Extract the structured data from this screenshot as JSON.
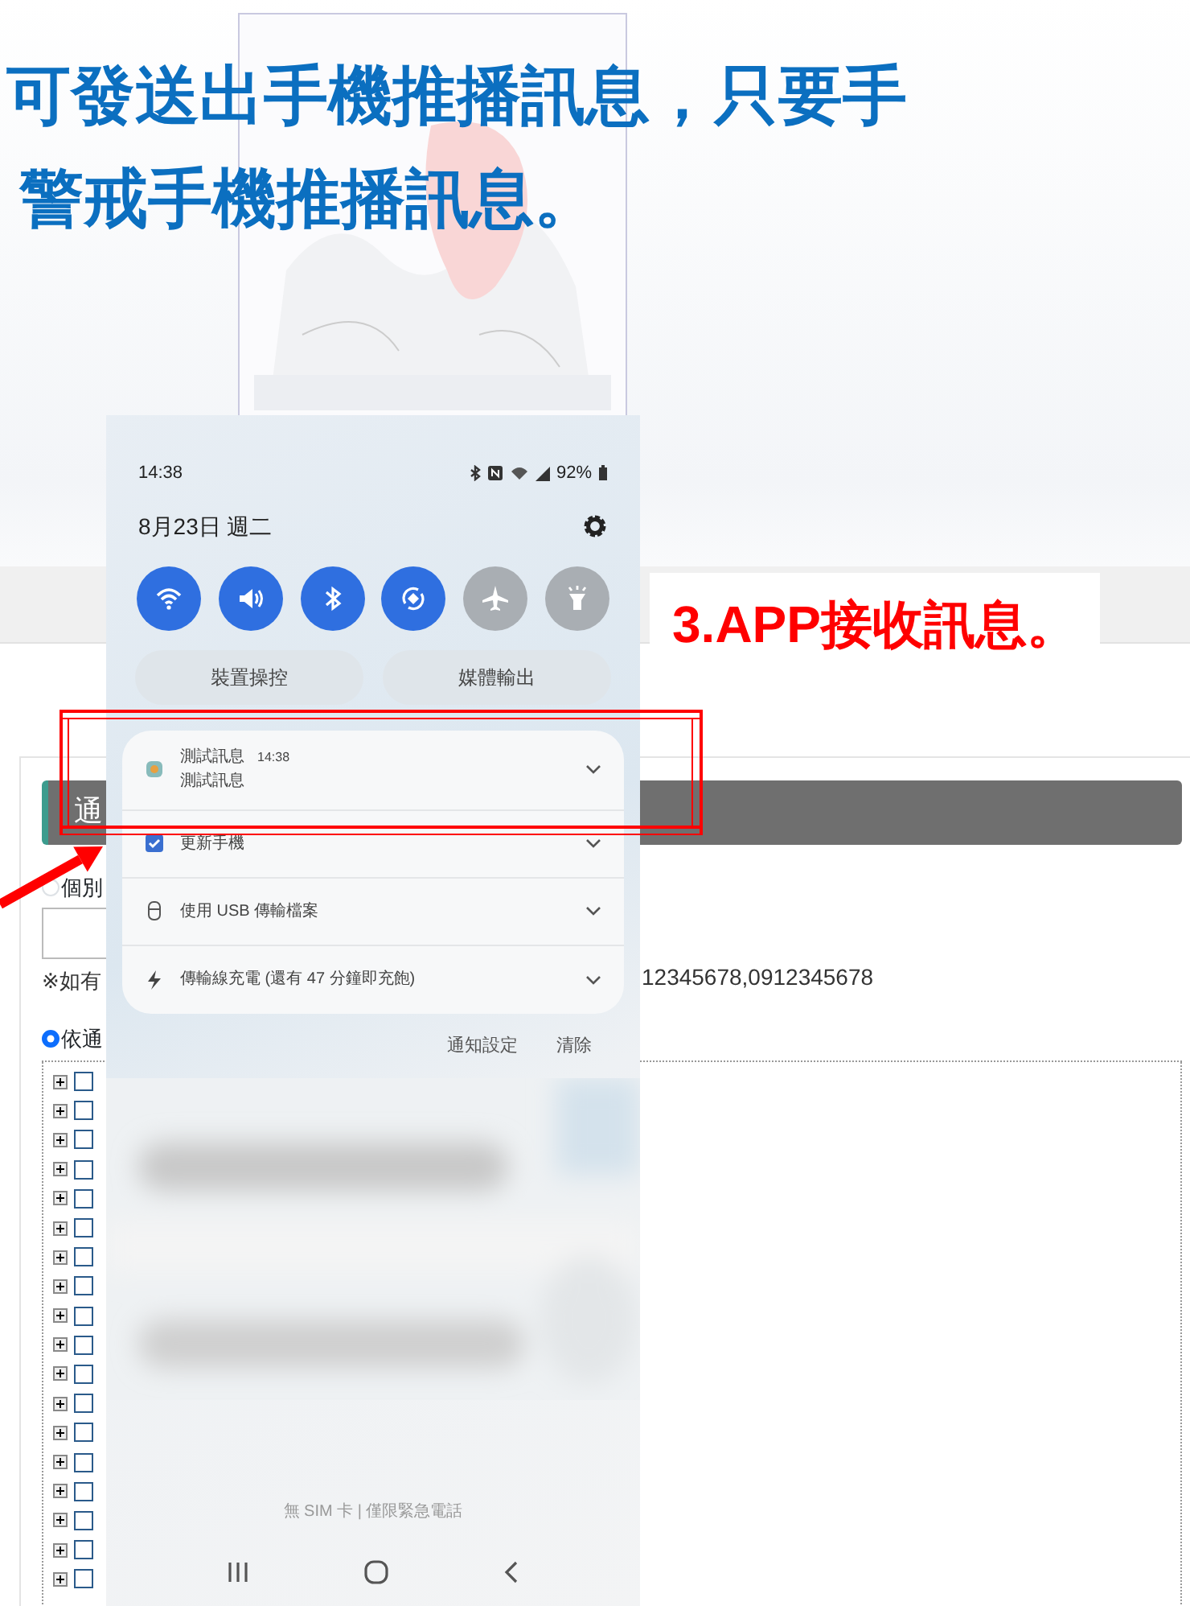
{
  "slide": {
    "heading_lines": [
      "可發送出手機推播訊息，只要手",
      "警戒手機推播訊息。"
    ],
    "callout": "3.APP接收訊息。"
  },
  "web_form": {
    "section_title": "通",
    "radios": [
      {
        "label": "個別",
        "selected": false
      },
      {
        "label": "依通",
        "selected": true
      }
    ],
    "note": "※如有",
    "note_numbers": "12345678,0912345678",
    "tree": [
      {
        "expanded": false,
        "checked": false
      },
      {
        "expanded": false,
        "checked": false
      },
      {
        "expanded": false,
        "checked": false
      },
      {
        "expanded": false,
        "checked": false
      },
      {
        "expanded": false,
        "checked": false
      },
      {
        "expanded": false,
        "checked": false
      },
      {
        "expanded": false,
        "checked": false
      },
      {
        "expanded": false,
        "checked": false
      },
      {
        "expanded": false,
        "checked": false
      },
      {
        "expanded": false,
        "checked": false
      },
      {
        "expanded": false,
        "checked": false
      },
      {
        "expanded": false,
        "checked": false
      },
      {
        "expanded": false,
        "checked": false
      },
      {
        "expanded": false,
        "checked": false
      },
      {
        "expanded": false,
        "checked": false
      },
      {
        "expanded": false,
        "checked": false
      },
      {
        "expanded": false,
        "checked": false
      },
      {
        "expanded": false,
        "checked": false
      }
    ]
  },
  "phone": {
    "time": "14:38",
    "battery": "92%",
    "date": "8月23日 週二",
    "toggles": [
      {
        "kind": "wifi",
        "on": true
      },
      {
        "kind": "sound",
        "on": true
      },
      {
        "kind": "bluetooth",
        "on": true
      },
      {
        "kind": "rotate",
        "on": true
      },
      {
        "kind": "airplane",
        "on": false
      },
      {
        "kind": "flashlight",
        "on": false
      }
    ],
    "quick_buttons": [
      "裝置操控",
      "媒體輸出"
    ],
    "notifications": [
      {
        "kind": "message",
        "title": "測試訊息",
        "time": "14:38",
        "body": "測試訊息"
      },
      {
        "kind": "update",
        "title": "更新手機"
      },
      {
        "kind": "usb",
        "title": "使用 USB 傳輸檔案"
      },
      {
        "kind": "charging",
        "title": "傳輸線充電 (還有 47 分鐘即充飽)"
      }
    ],
    "footer_links": [
      "通知設定",
      "清除"
    ],
    "sim_status": "無 SIM 卡 | 僅限緊急電話"
  }
}
